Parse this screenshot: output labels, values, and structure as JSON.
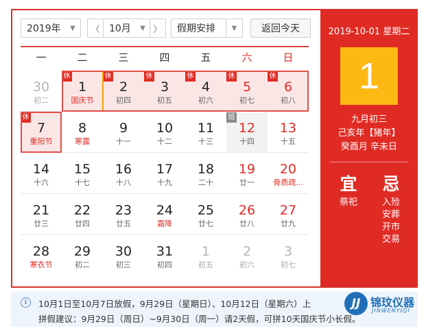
{
  "toolbar": {
    "year": "2019年",
    "month": "10月",
    "prev_arrow": "〈",
    "next_arrow": "〉",
    "holiday": "假期安排",
    "today": "返回今天"
  },
  "weekdays": [
    "一",
    "二",
    "三",
    "四",
    "五",
    "六",
    "日"
  ],
  "weeks": [
    [
      {
        "day": "30",
        "lunar": "初二",
        "dim": true
      },
      {
        "day": "1",
        "lunar": "国庆节",
        "badge": "休",
        "festival": true
      },
      {
        "day": "2",
        "lunar": "初四",
        "badge": "休"
      },
      {
        "day": "3",
        "lunar": "初五",
        "badge": "休"
      },
      {
        "day": "4",
        "lunar": "初六",
        "badge": "休"
      },
      {
        "day": "5",
        "lunar": "初七",
        "badge": "休",
        "weekend": true
      },
      {
        "day": "6",
        "lunar": "初八",
        "badge": "休",
        "weekend": true
      }
    ],
    [
      {
        "day": "7",
        "lunar": "重阳节",
        "badge": "休",
        "festival": true
      },
      {
        "day": "8",
        "lunar": "寒露",
        "festival": true
      },
      {
        "day": "9",
        "lunar": "十一"
      },
      {
        "day": "10",
        "lunar": "十二"
      },
      {
        "day": "11",
        "lunar": "十三"
      },
      {
        "day": "12",
        "lunar": "十四",
        "badge": "班",
        "weekend": true,
        "workday": true
      },
      {
        "day": "13",
        "lunar": "十五",
        "weekend": true
      }
    ],
    [
      {
        "day": "14",
        "lunar": "十六"
      },
      {
        "day": "15",
        "lunar": "十七"
      },
      {
        "day": "16",
        "lunar": "十八"
      },
      {
        "day": "17",
        "lunar": "十九"
      },
      {
        "day": "18",
        "lunar": "二十"
      },
      {
        "day": "19",
        "lunar": "廿一",
        "weekend": true
      },
      {
        "day": "20",
        "lunar": "骨质疏...",
        "weekend": true,
        "festival": true
      }
    ],
    [
      {
        "day": "21",
        "lunar": "廿三"
      },
      {
        "day": "22",
        "lunar": "廿四"
      },
      {
        "day": "23",
        "lunar": "廿五"
      },
      {
        "day": "24",
        "lunar": "霜降",
        "festival": true
      },
      {
        "day": "25",
        "lunar": "廿七"
      },
      {
        "day": "26",
        "lunar": "廿八",
        "weekend": true
      },
      {
        "day": "27",
        "lunar": "廿九",
        "weekend": true
      }
    ],
    [
      {
        "day": "28",
        "lunar": "寒衣节",
        "festival": true
      },
      {
        "day": "29",
        "lunar": "初二"
      },
      {
        "day": "30",
        "lunar": "初三"
      },
      {
        "day": "31",
        "lunar": "初四"
      },
      {
        "day": "1",
        "lunar": "初五",
        "dim": true
      },
      {
        "day": "2",
        "lunar": "初六",
        "dim": true
      },
      {
        "day": "3",
        "lunar": "初七",
        "dim": true
      }
    ]
  ],
  "panel": {
    "date_line": "2019-10-01 星期二",
    "day": "1",
    "lunar_date": "九月初三",
    "ganzhi_year": "己亥年【猪年】",
    "ganzhi_month_day": "癸酉月 辛未日",
    "yi_title": "宜",
    "yi_items": [
      "祭祀"
    ],
    "ji_title": "忌",
    "ji_items": [
      "入殓",
      "安葬",
      "开市",
      "交易"
    ]
  },
  "notice": {
    "icon": "i",
    "line1": "10月1日至10月7日放假，9月29日（星期日）、10月12日（星期六）上",
    "line2": "拼假建议：9月29日（周日）~9月30日（周一）请2天假，可拼10天国庆节小长假。"
  },
  "watermark": {
    "logo": "JJ",
    "name": "锦玟仪器",
    "name_en": "JINWENYIQI"
  },
  "colors": {
    "accent": "#e02b25",
    "today_box": "#fcb813",
    "holiday_bg": "#fbe6e6"
  }
}
